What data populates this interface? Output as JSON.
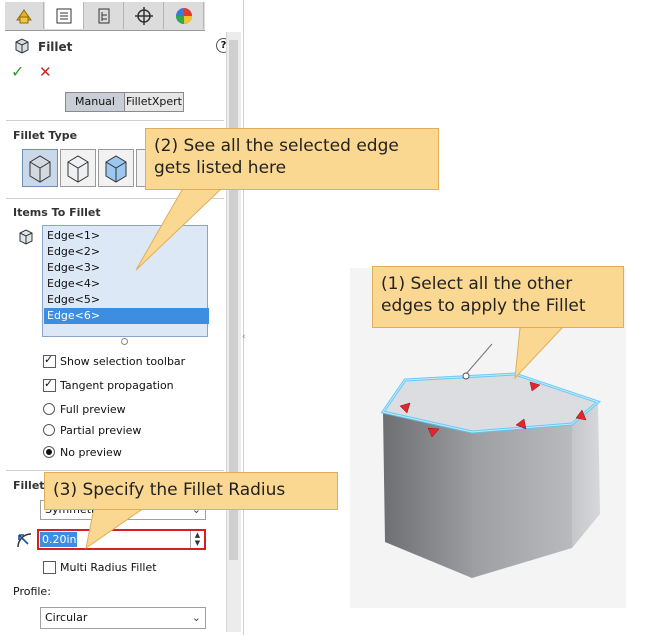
{
  "panel": {
    "tabs": [
      "feature-manager-icon",
      "property-manager-icon",
      "configuration-manager-icon",
      "dimxpert-icon",
      "display-manager-icon"
    ],
    "title": "Fillet",
    "help_icon": "?",
    "ok_icon": "✓",
    "cancel_icon": "✕",
    "mode_buttons": [
      "Manual",
      "FilletXpert"
    ],
    "fillet_type_header": "Fillet Type",
    "items_header": "Items To Fillet",
    "edges": [
      "Edge<1>",
      "Edge<2>",
      "Edge<3>",
      "Edge<4>",
      "Edge<5>",
      "Edge<6>"
    ],
    "selected_edge": "Edge<6>",
    "options": {
      "show_selection_toolbar": "Show selection toolbar",
      "tangent_propagation": "Tangent propagation",
      "full_preview": "Full preview",
      "partial_preview": "Partial preview",
      "no_preview": "No preview"
    },
    "fillet_params_header_partial": "Fillet P",
    "symmetric_partial": "Symmetric",
    "radius_value": "0.20in",
    "multi_radius": "Multi Radius Fillet",
    "profile_label": "Profile:",
    "profile_value": "Circular"
  },
  "callouts": {
    "c1": "(1) Select all the other edges to apply the Fillet",
    "c2": "(2) See all the selected edge gets listed here",
    "c3": "(3) Specify the Fillet Radius"
  },
  "colors": {
    "callout_fill": "#fbd891",
    "list_bg": "#dce8f5",
    "selection_blue": "#3d8ee0",
    "highlight_red": "#e3262d",
    "edge_glow": "#5cc8f5"
  }
}
